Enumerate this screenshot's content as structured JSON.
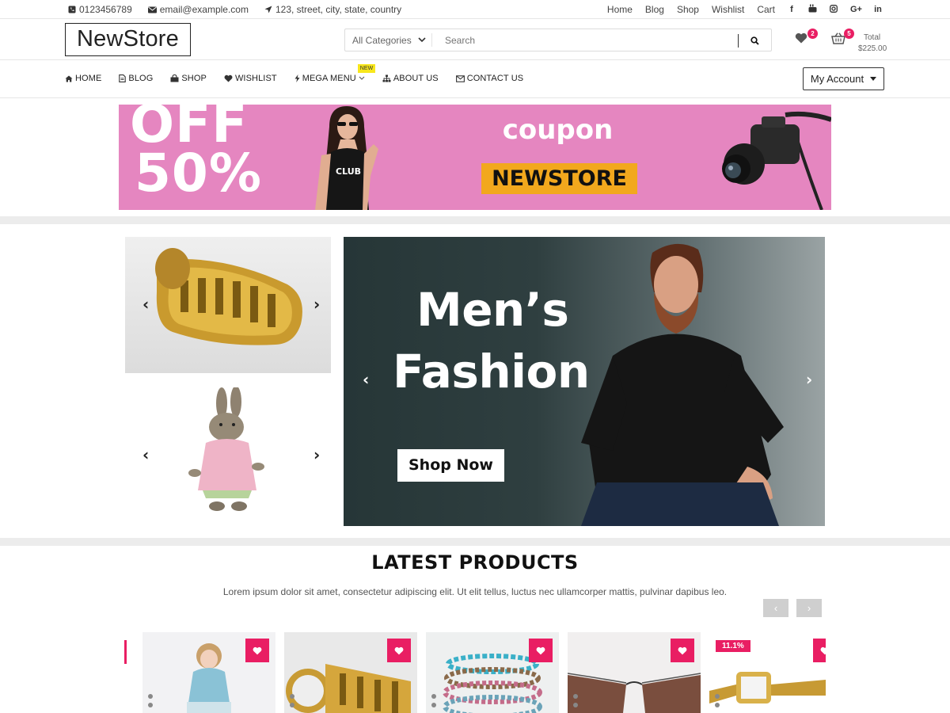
{
  "topbar": {
    "phone": "0123456789",
    "email": "email@example.com",
    "address": "123, street, city, state, country",
    "links": [
      "Home",
      "Blog",
      "Shop",
      "Wishlist",
      "Cart"
    ],
    "social": [
      "facebook-icon",
      "youtube-icon",
      "instagram-icon",
      "google-plus-icon",
      "linkedin-icon"
    ]
  },
  "header": {
    "logo": "NewStore",
    "search": {
      "category": "All Categories",
      "placeholder": "Search"
    },
    "wishlist_count": "2",
    "cart_count": "5",
    "total_label": "Total",
    "total_value": "$225.00"
  },
  "nav": {
    "items": [
      {
        "label": "HOME",
        "icon": "home-icon"
      },
      {
        "label": "BLOG",
        "icon": "document-icon"
      },
      {
        "label": "SHOP",
        "icon": "shopping-bag-icon"
      },
      {
        "label": "WISHLIST",
        "icon": "heart-icon"
      },
      {
        "label": "MEGA MENU",
        "icon": "bolt-icon",
        "badge": "NEW"
      },
      {
        "label": "ABOUT US",
        "icon": "sitemap-icon"
      },
      {
        "label": "CONTACT US",
        "icon": "envelope-icon"
      }
    ],
    "account": "My Account"
  },
  "coupon": {
    "off_line1": "OFF",
    "off_line2": "50%",
    "coupon_word": "coupon",
    "code": "NEWSTORE"
  },
  "hero": {
    "line1": "Men’s",
    "line2": "Fashion",
    "button": "Shop Now"
  },
  "latest": {
    "title": "LATEST PRODUCTS",
    "subtitle": "Lorem ipsum dolor sit amet, consectetur adipiscing elit. Ut elit tellus, luctus nec ullamcorper mattis, pulvinar dapibus leo.",
    "sale_badge": "11.1%"
  },
  "colors": {
    "accent": "#e91e63",
    "coupon_bg": "#e586c0",
    "coupon_code_bg": "#f2a81d",
    "new_badge": "#f8e71c",
    "hero_bg": "#263637"
  }
}
